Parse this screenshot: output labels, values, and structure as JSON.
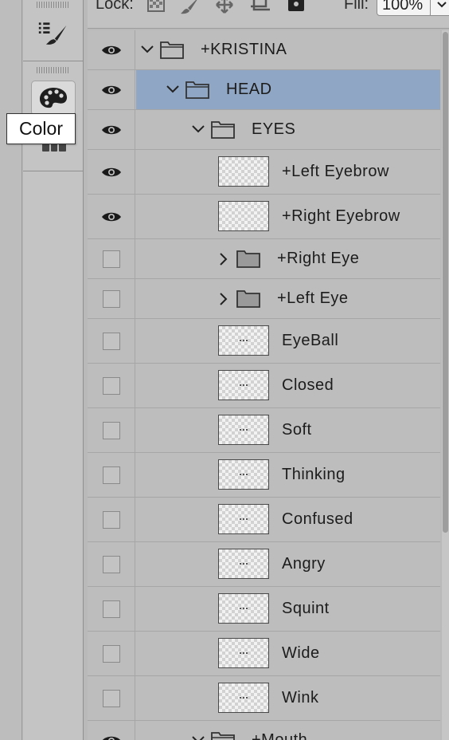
{
  "toolbar": {
    "lock_label": "Lock:",
    "fill_label": "Fill:",
    "fill_value": "100%"
  },
  "tools": {
    "tooltip": "Color"
  },
  "layers": [
    {
      "name": "+KRISTINA",
      "kind": "group",
      "expanded": true,
      "visible": true,
      "level": 0
    },
    {
      "name": "HEAD",
      "kind": "group",
      "expanded": true,
      "visible": true,
      "level": 1,
      "selected": true
    },
    {
      "name": "EYES",
      "kind": "group",
      "expanded": true,
      "visible": true,
      "level": 2
    },
    {
      "name": "+Left Eyebrow",
      "kind": "layer",
      "visible": true
    },
    {
      "name": "+Right Eyebrow",
      "kind": "layer",
      "visible": true
    },
    {
      "name": "+Right Eye",
      "kind": "group",
      "expanded": false,
      "visible": false
    },
    {
      "name": "+Left Eye",
      "kind": "group",
      "expanded": false,
      "visible": false
    },
    {
      "name": "EyeBall",
      "kind": "layer",
      "visible": false
    },
    {
      "name": "Closed",
      "kind": "layer",
      "visible": false
    },
    {
      "name": "Soft",
      "kind": "layer",
      "visible": false
    },
    {
      "name": "Thinking",
      "kind": "layer",
      "visible": false
    },
    {
      "name": "Confused",
      "kind": "layer",
      "visible": false
    },
    {
      "name": "Angry",
      "kind": "layer",
      "visible": false
    },
    {
      "name": "Squint",
      "kind": "layer",
      "visible": false
    },
    {
      "name": "Wide",
      "kind": "layer",
      "visible": false
    },
    {
      "name": "Wink",
      "kind": "layer",
      "visible": false
    },
    {
      "name": "+Mouth",
      "kind": "group",
      "expanded": true,
      "visible": true
    }
  ],
  "colors": {
    "selection": "#8fa6c4",
    "panel": "#bdbdbd"
  }
}
